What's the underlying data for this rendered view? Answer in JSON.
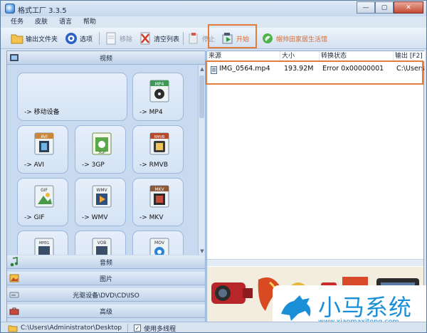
{
  "window": {
    "title": "格式工厂 3.3.5",
    "buttons": [
      "—",
      "▢",
      "✕"
    ]
  },
  "menu": [
    "任务",
    "皮肤",
    "语言",
    "帮助"
  ],
  "toolbar": {
    "output_folder": "输出文件夹",
    "options": "选项",
    "remove": "移除",
    "clear_list": "清空列表",
    "stop": "停止",
    "start": "开始",
    "promo": "帽帅田家居生活馆",
    "accent_orange": "#e57b3c"
  },
  "left_panel": {
    "video_header": "视频",
    "tiles": [
      {
        "label": "-> 移动设备",
        "icon": "mobile-device-icon"
      },
      {
        "label": "-> MP4",
        "badge": "MP4",
        "icon": "mp4-film-icon"
      },
      {
        "label": "-> AVI",
        "badge": "AVI",
        "icon": "avi-film-icon"
      },
      {
        "label": "-> 3GP",
        "badge": "3GP",
        "icon": "3gp-film-icon"
      },
      {
        "label": "-> RMVB",
        "badge": "RMVB",
        "icon": "rmvb-film-icon"
      },
      {
        "label": "-> GIF",
        "badge": "GIF",
        "icon": "gif-image-icon"
      },
      {
        "label": "-> WMV",
        "badge": "WMV",
        "icon": "wmv-film-icon"
      },
      {
        "label": "-> MKV",
        "badge": "MKV",
        "icon": "mkv-film-icon"
      },
      {
        "label": "",
        "badge": "MPEG",
        "icon": "mpeg-film-icon"
      },
      {
        "label": "",
        "badge": "VOB",
        "icon": "vob-film-icon"
      },
      {
        "label": "",
        "badge": "MOV",
        "icon": "mov-film-icon"
      }
    ],
    "categories": [
      {
        "label": "音频",
        "icon": "music-note-icon"
      },
      {
        "label": "图片",
        "icon": "picture-icon"
      },
      {
        "label": "光驱设备\\DVD\\CD\\ISO",
        "icon": "disc-drive-icon"
      },
      {
        "label": "高级",
        "icon": "toolbox-icon"
      }
    ]
  },
  "task_list": {
    "columns": [
      "来源",
      "大小",
      "转换状态",
      "输出 [F2]"
    ],
    "rows": [
      {
        "source": "IMG_0564.mp4",
        "size": "193.92M",
        "status": "Error 0x00000001",
        "output": "C:\\Users"
      }
    ]
  },
  "status_bar": {
    "path": "C:\\Users\\Administrator\\Desktop",
    "multithread_label": "使用多线程",
    "multithread_checked": "✓"
  },
  "watermark": {
    "text": "小马系统",
    "url": "www.xiaomaxitong.com"
  }
}
